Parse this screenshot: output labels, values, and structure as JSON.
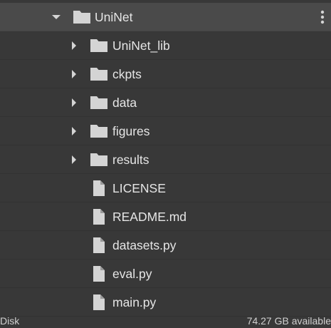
{
  "tree": {
    "root": {
      "name": "UniNet",
      "expanded": true
    },
    "items": [
      {
        "name": "UniNet_lib",
        "type": "folder"
      },
      {
        "name": "ckpts",
        "type": "folder"
      },
      {
        "name": "data",
        "type": "folder"
      },
      {
        "name": "figures",
        "type": "folder"
      },
      {
        "name": "results",
        "type": "folder"
      },
      {
        "name": "LICENSE",
        "type": "file"
      },
      {
        "name": "README.md",
        "type": "file"
      },
      {
        "name": "datasets.py",
        "type": "file"
      },
      {
        "name": "eval.py",
        "type": "file"
      },
      {
        "name": "main.py",
        "type": "file"
      }
    ]
  },
  "footer": {
    "disk_label": "Disk",
    "available": "74.27 GB available"
  },
  "colors": {
    "background": "#383838",
    "selected_row": "#4a4a4a",
    "icon": "#d4d4d4"
  },
  "icons": {
    "folder": "folder-icon",
    "file": "file-icon",
    "expand": "caret-right-icon",
    "collapse": "caret-down-icon",
    "menu": "more-vert-icon"
  }
}
